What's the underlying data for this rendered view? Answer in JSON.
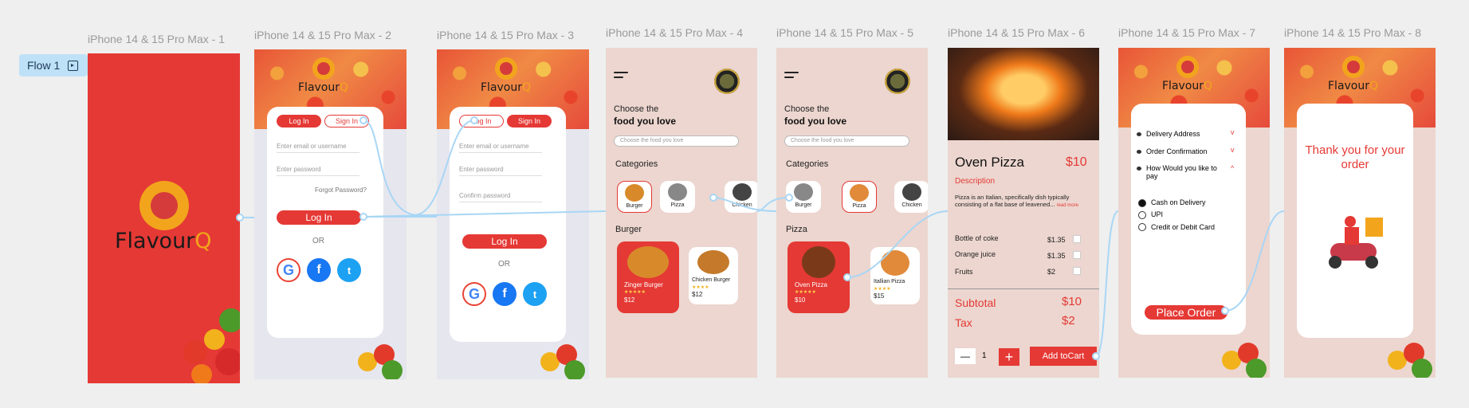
{
  "flow_tag": "Flow 1",
  "frames": [
    "iPhone 14 & 15 Pro Max - 1",
    "iPhone 14 & 15 Pro Max - 2",
    "iPhone 14 & 15 Pro Max - 3",
    "iPhone 14 & 15 Pro Max - 4",
    "iPhone 14 & 15 Pro Max - 5",
    "iPhone 14 & 15 Pro Max - 6",
    "iPhone 14 & 15 Pro Max - 7",
    "iPhone 14 & 15 Pro Max - 8"
  ],
  "brand": {
    "name_a": "Flavour",
    "name_b": "Q",
    "red": "#e53935",
    "orange": "#f2a51c"
  },
  "login": {
    "tab_login": "Log In",
    "tab_signin": "Sign In",
    "email_placeholder": "Enter email or username",
    "password_placeholder": "Enter password",
    "forgot": "Forgot Password?",
    "login_button": "Log In",
    "or": "OR"
  },
  "signup": {
    "tab_login": "Log In",
    "tab_signin": "Sign In",
    "email_placeholder": "Enter email or username",
    "password_placeholder": "Enter password",
    "confirm_placeholder": "Confirm password",
    "login_button": "Log In",
    "or": "OR"
  },
  "home": {
    "heading_1": "Choose the",
    "heading_2": "food you love",
    "search_placeholder": "Choose the food you love",
    "categories_title": "Categories",
    "categories": [
      "Burger",
      "Pizza",
      "Chicken"
    ]
  },
  "home_burger": {
    "section": "Burger",
    "items": [
      {
        "name": "Zinger Burger",
        "stars": "★★★★★",
        "price": "$12"
      },
      {
        "name": "Chicken Burger",
        "stars": "★★★★",
        "price": "$12"
      }
    ]
  },
  "home_pizza": {
    "section": "Pizza",
    "items": [
      {
        "name": "Oven Pizza",
        "stars": "★★★★★",
        "price": "$10"
      },
      {
        "name": "Itallian Pizza",
        "stars": "★★★★",
        "price": "$15"
      }
    ]
  },
  "detail": {
    "title": "Oven Pizza",
    "price": "$10",
    "desc_label": "Description",
    "desc_text": "Pizza is an Italian, specifically dish typically consisting of a flat base of leavened...",
    "read_more": "read more",
    "addons": [
      {
        "name": "Bottle of coke",
        "price": "$1.35"
      },
      {
        "name": "Orange juice",
        "price": "$1.35"
      },
      {
        "name": "Fruits",
        "price": "$2"
      }
    ],
    "subtotal_label": "Subtotal",
    "subtotal": "$10",
    "tax_label": "Tax",
    "tax": "$2",
    "minus": "—",
    "qty": "1",
    "plus": "+",
    "add_to_cart": "Add toCart"
  },
  "checkout": {
    "steps": [
      {
        "label": "Delivery Address",
        "chevron": "v"
      },
      {
        "label": "Order Confirmation",
        "chevron": "v"
      },
      {
        "label": "How Would you like to pay",
        "chevron": "^"
      }
    ],
    "payments": [
      "Cash on Delivery",
      "UPI",
      "Credit or Debit Card"
    ],
    "place_order": "Place Order"
  },
  "thanks": {
    "message": "Thank you for your order"
  }
}
